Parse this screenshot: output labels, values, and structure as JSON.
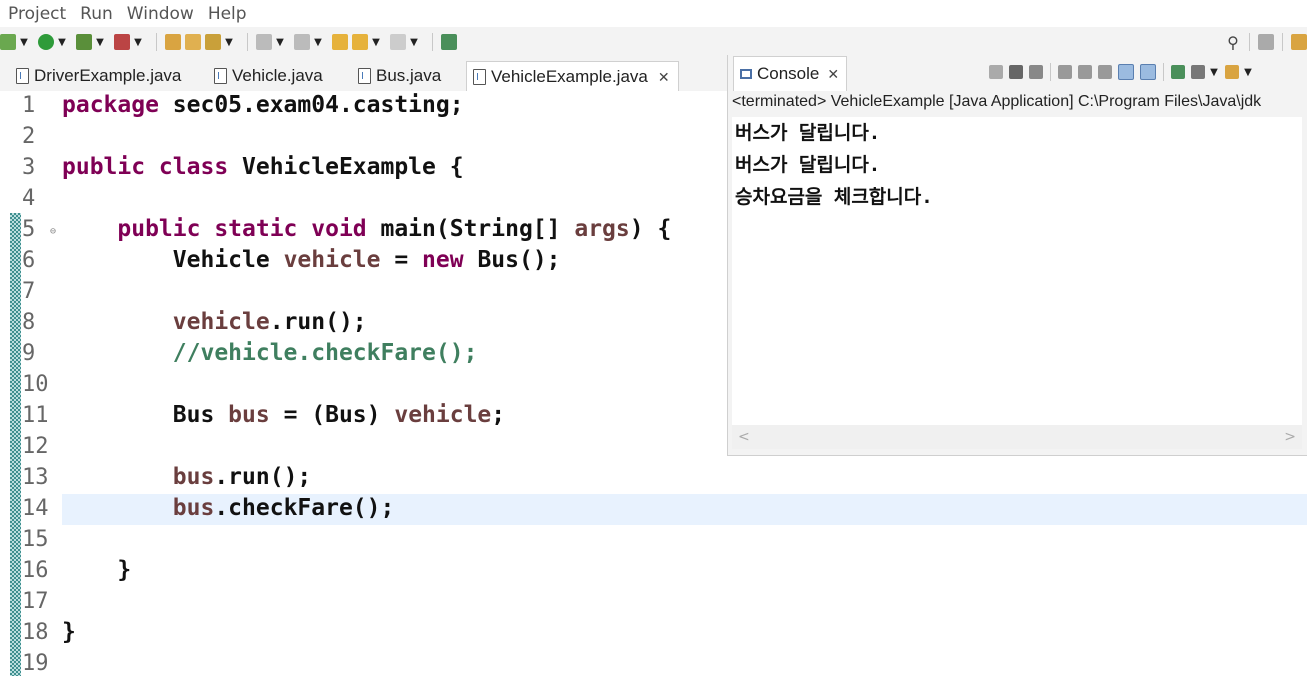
{
  "menu": [
    "Project",
    "Run",
    "Window",
    "Help"
  ],
  "editor_tabs": [
    {
      "label": "DriverExample.java"
    },
    {
      "label": "Vehicle.java"
    },
    {
      "label": "Bus.java"
    },
    {
      "label": "VehicleExample.java",
      "active": true
    }
  ],
  "code": {
    "line_numbers": [
      "1",
      "2",
      "3",
      "4",
      "5",
      "6",
      "7",
      "8",
      "9",
      "10",
      "11",
      "12",
      "13",
      "14",
      "15",
      "16",
      "17",
      "18",
      "19"
    ],
    "highlighted_line": "14",
    "lines": {
      "l1": {
        "kw": "package",
        "rest": " sec05.exam04.casting;"
      },
      "l3": {
        "kw": "public class",
        "rest": " VehicleExample {"
      },
      "l5": {
        "indent": "    ",
        "kw": "public static void",
        "mid": " main(String[] ",
        "var": "args",
        "rest": ") {"
      },
      "l6": {
        "indent": "        ",
        "type": "Vehicle ",
        "var": "vehicle",
        "op": " = ",
        "kw": "new",
        "rest": " Bus();"
      },
      "l8": {
        "indent": "        ",
        "var": "vehicle",
        "rest": ".run();"
      },
      "l9": {
        "indent": "        ",
        "comment": "//vehicle.checkFare();"
      },
      "l11": {
        "indent": "        ",
        "type": "Bus ",
        "var": "bus",
        "mid": " = (Bus) ",
        "var2": "vehicle",
        "rest": ";"
      },
      "l13": {
        "indent": "        ",
        "var": "bus",
        "rest": ".run();"
      },
      "l14": {
        "indent": "        ",
        "var": "bus",
        "rest": ".checkFare();"
      },
      "l16": {
        "indent": "    ",
        "rest": "}"
      },
      "l18": {
        "rest": "}"
      }
    }
  },
  "console": {
    "tab_label": "Console",
    "status": "<terminated> VehicleExample [Java Application] C:\\Program Files\\Java\\jdk",
    "output": [
      "버스가 달립니다.",
      "버스가 달립니다.",
      "승차요금을 체크합니다."
    ]
  },
  "colors": {
    "keyword": "#7f0055",
    "variable": "#6a3e3e",
    "comment": "#3f7f5f",
    "current_line": "#e8f2fe"
  }
}
